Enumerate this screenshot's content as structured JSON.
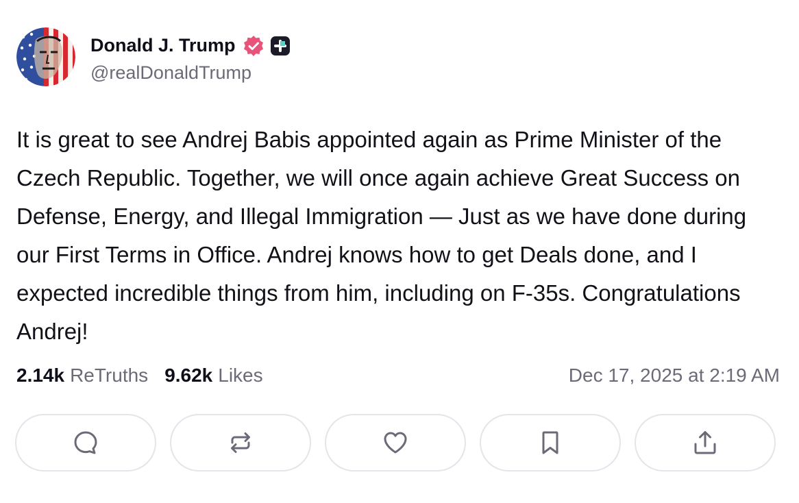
{
  "author": {
    "display_name": "Donald J. Trump",
    "handle": "@realDonaldTrump",
    "avatar": "avatar-flag-portrait",
    "verified_icon": "verified-badge-icon",
    "plus_icon": "plus-badge-icon"
  },
  "post": {
    "text": "It is great to see Andrej Babis appointed again as Prime Minister of the Czech Republic. Together, we will once again achieve Great Success on Defense, Energy, and Illegal Immigration — Just as we have done during our First Terms in Office. Andrej knows how to get Deals done, and I expected incredible things from him, including on F-35s. Congratulations Andrej!"
  },
  "stats": {
    "retruths_count": "2.14k",
    "retruths_label": "ReTruths",
    "likes_count": "9.62k",
    "likes_label": "Likes",
    "timestamp": "Dec 17, 2025 at 2:19 AM"
  },
  "actions": [
    {
      "name": "reply",
      "icon": "comment-icon"
    },
    {
      "name": "retruth",
      "icon": "repost-icon"
    },
    {
      "name": "like",
      "icon": "heart-icon"
    },
    {
      "name": "bookmark",
      "icon": "bookmark-icon"
    },
    {
      "name": "share",
      "icon": "share-icon"
    }
  ],
  "colors": {
    "verified": "#e8537a",
    "text_primary": "#0f0f1a",
    "text_secondary": "#6b6b78",
    "button_border": "#e4e4ea"
  }
}
